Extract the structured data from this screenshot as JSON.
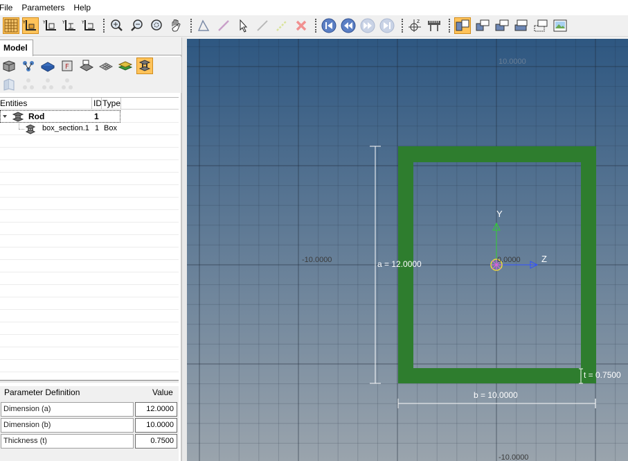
{
  "menu": {
    "file": "File",
    "parameters": "Parameters",
    "help": "Help"
  },
  "toolbar": {
    "icons": [
      "grid-icon",
      "axis-yz-icon",
      "axis-yz-2-icon",
      "axis-yz-3-icon",
      "axis-yz-4-icon",
      "zoom-in-icon",
      "zoom-out-icon",
      "zoom-fit-icon",
      "pan-icon",
      "triangle-icon",
      "line-icon",
      "pointer-icon",
      "dotted-line-icon",
      "dashed-line-icon",
      "delete-icon",
      "first-icon",
      "rewind-icon",
      "forward-icon",
      "last-icon",
      "axis-settings-icon",
      "measure-icon",
      "view-1-icon",
      "view-2-icon",
      "view-3-icon",
      "view-4-icon",
      "view-5-icon",
      "view-image-icon"
    ]
  },
  "panel": {
    "tab": "Model",
    "tree_headers": {
      "entities": "Entities",
      "id": "ID",
      "type": "Type"
    },
    "tree": [
      {
        "name": "Rod",
        "id": "1",
        "type": ""
      },
      {
        "name": "box_section.1",
        "id": "1",
        "type": "Box"
      }
    ]
  },
  "params": {
    "header_def": "Parameter Definition",
    "header_val": "Value",
    "rows": [
      {
        "label": "Dimension (a)",
        "value": "12.0000"
      },
      {
        "label": "Dimension (b)",
        "value": "10.0000"
      },
      {
        "label": "Thickness (t)",
        "value": "0.7500"
      }
    ]
  },
  "viewport": {
    "axis_ticks": {
      "top": "10.0000",
      "left": "-10.0000",
      "origin": "0.0000",
      "bottom": "-10.0000"
    },
    "dims": {
      "a": "a = 12.0000",
      "b": "b = 10.0000",
      "t": "t = 0.7500"
    },
    "axes": {
      "y": "Y",
      "z": "Z"
    },
    "colors": {
      "section": "#2e7d2e",
      "bg_top": "#2e5781",
      "bg_bottom": "#9aa4ad"
    }
  }
}
